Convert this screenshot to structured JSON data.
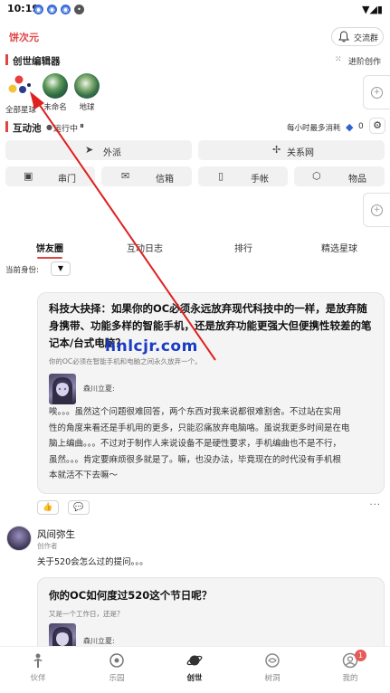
{
  "status_bar": {
    "time": "10:19"
  },
  "app": {
    "logo": "饼次元",
    "chat_button": "交流群"
  },
  "creator": {
    "title": "创世编辑器",
    "advanced": "进阶创作",
    "worlds": [
      {
        "name": "全部星球"
      },
      {
        "name": "未命名"
      },
      {
        "name": "地球"
      }
    ]
  },
  "interaction": {
    "title": "互动池",
    "status": "运行中",
    "consumption": "每小时最多消耗",
    "balance": "0",
    "buttons": [
      {
        "label": "外派",
        "icon": "send-icon"
      },
      {
        "label": "关系网",
        "icon": "network-icon"
      },
      {
        "label": "串门",
        "icon": "visit-icon"
      },
      {
        "label": "信箱",
        "icon": "mail-icon"
      },
      {
        "label": "手帐",
        "icon": "phone-icon"
      },
      {
        "label": "物品",
        "icon": "box-icon"
      }
    ]
  },
  "tabs": [
    {
      "label": "饼友圈"
    },
    {
      "label": "互动日志"
    },
    {
      "label": "排行"
    },
    {
      "label": "精选星球"
    }
  ],
  "identity": {
    "label": "当前身份:",
    "value": "▼"
  },
  "posts": [
    {
      "title_lines": [
        "科技大抉择：如果你的OC必须永远放弃现代科技中的一样，是放弃随",
        "身携带、功能多样的智能手机，还是放弃功能更强大但便携性较差的笔",
        "记本/台式电脑？"
      ],
      "subtitle": "你的OC必须在智能手机和电脑之间永久放弃一个。",
      "author": "森川立夏:",
      "body_lines": [
        "唉。。。虽然这个问题很难回答，两个东西对我来说都很难割舍。不过站在实用",
        "性的角度来看还是手机用的更多，只能忍痛放弃电脑咯。虽说我更多时间是在电",
        "脑上编曲。。。不过对于制作人来说设备不是硬性要求，手机编曲也不是不行，",
        "虽然。。。肯定要麻烦很多就是了。嘛，也没办法，毕竟现在的时代没有手机根",
        "本就活不下去嘛～"
      ]
    }
  ],
  "user": {
    "name": "风间弥生",
    "role": "创作者",
    "post": "关于520会怎么过的提问。。。",
    "card": {
      "title": "你的OC如何度过520这个节日呢？",
      "subtitle": "又是一个工作日，还是？",
      "author": "森川立夏:"
    }
  },
  "watermark": "hnlcjr.com",
  "bottom_nav": [
    {
      "label": "伙伴",
      "icon": "partner-icon"
    },
    {
      "label": "乐园",
      "icon": "paradise-icon"
    },
    {
      "label": "创世",
      "icon": "planet-icon"
    },
    {
      "label": "树洞",
      "icon": "treehole-icon"
    },
    {
      "label": "我的",
      "icon": "profile-icon"
    }
  ],
  "notification_count": "1",
  "colors": {
    "accent": "#e04545",
    "watermark": "#1a3cc4",
    "arrow": "#e02020"
  }
}
